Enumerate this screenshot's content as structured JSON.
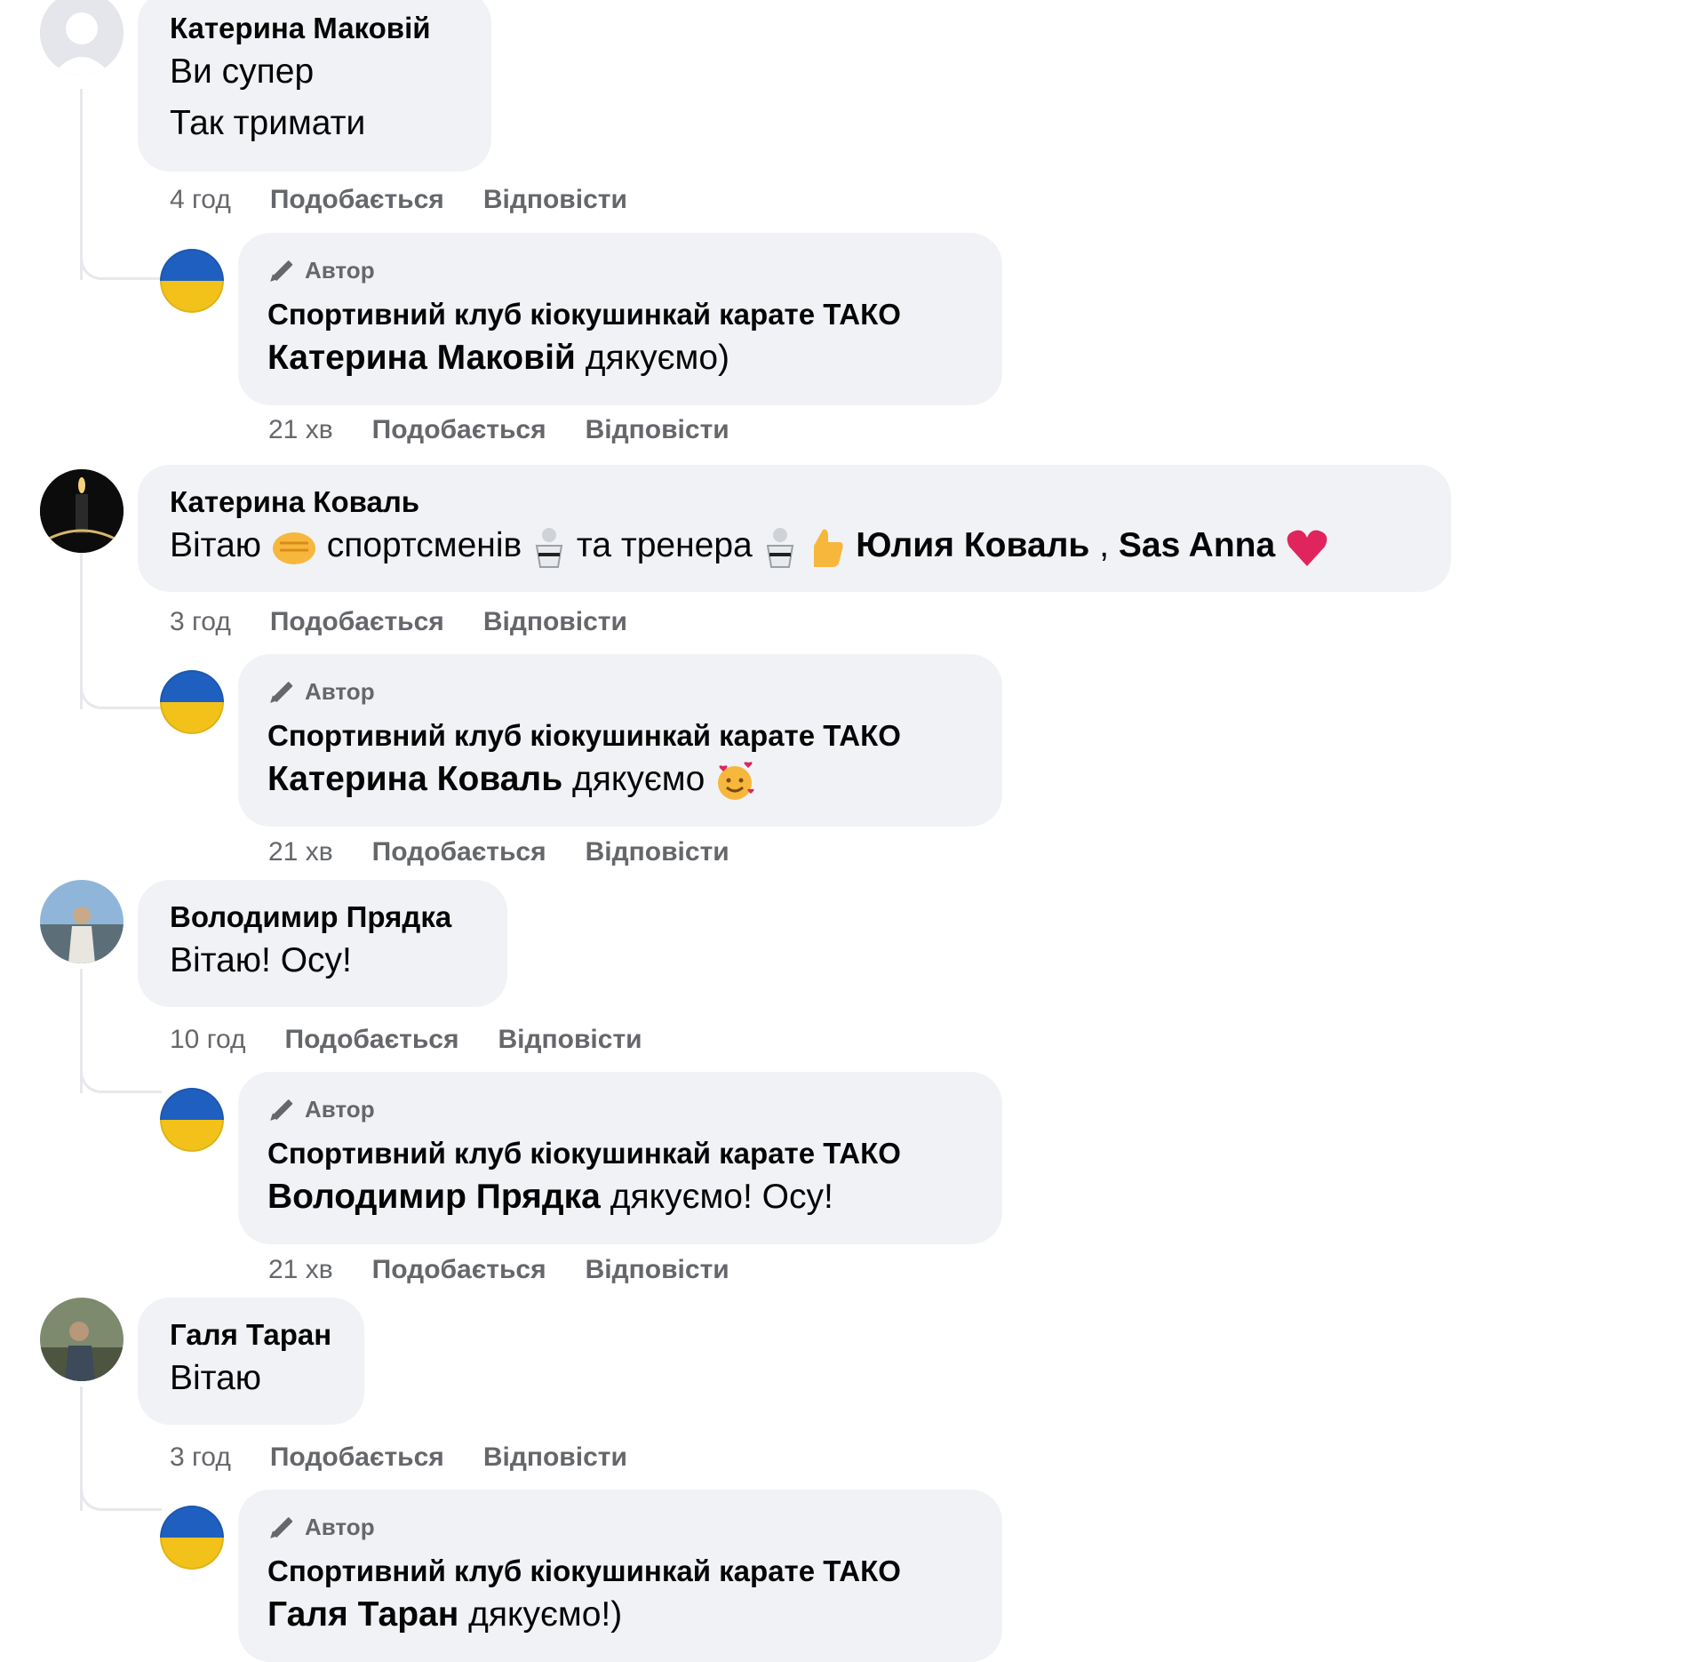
{
  "labels": {
    "like": "Подобається",
    "reply": "Відповісти",
    "author_badge": "Автор"
  },
  "page_name": "Спортивний клуб кіокушинкай карате ТАКО",
  "threads": [
    {
      "comment": {
        "author": "Катерина Маковій",
        "lines": [
          "Ви супер",
          "Так тримати"
        ],
        "time": "4 год"
      },
      "reply": {
        "mention": "Катерина Маковій",
        "text": " дякуємо)",
        "time": "21 хв"
      }
    },
    {
      "comment": {
        "author": "Катерина Коваль",
        "t1": "Вітаю",
        "t2": " спортсменів",
        "t3": " та тренера",
        "t4": "Юлия Коваль",
        "t5": " , ",
        "t6": "Sas Anna",
        "emojis": [
          "fist-bump-emoji",
          "martial-arts-emoji",
          "martial-arts-emoji",
          "thumbs-up-emoji",
          "red-heart-emoji"
        ],
        "time": "3 год"
      },
      "reply": {
        "mention": "Катерина Коваль",
        "text": " дякуємо",
        "emoji": "smiling-face-with-hearts-emoji",
        "time": "21 хв"
      }
    },
    {
      "comment": {
        "author": "Володимир Прядка",
        "lines": [
          "Вітаю! Осу!"
        ],
        "time": "10 год"
      },
      "reply": {
        "mention": "Володимир Прядка",
        "text": " дякуємо! Осу!",
        "time": "21 хв"
      }
    },
    {
      "comment": {
        "author": "Галя Таран",
        "lines": [
          "Вітаю"
        ],
        "time": "3 год"
      },
      "reply": {
        "mention": "Галя Таран",
        "text": " дякуємо!)"
      }
    }
  ],
  "colors": {
    "bubble": "#f0f2f5",
    "meta": "#65676b",
    "flag_blue": "#1f5fbf",
    "flag_yellow": "#f2c21b",
    "heart": "#e0245e"
  }
}
